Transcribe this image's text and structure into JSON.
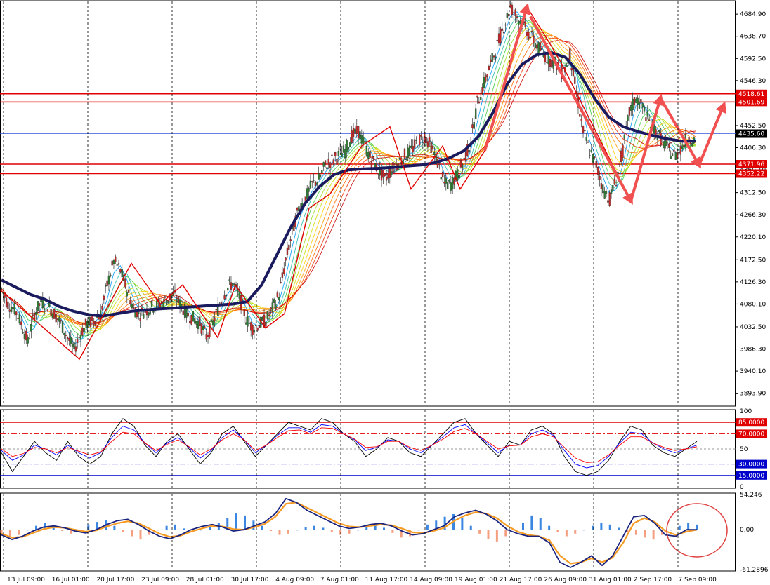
{
  "chart_data": {
    "type": "line",
    "instrument_note": "",
    "main_panel": {
      "type": "candlestick",
      "ylim": [
        3870,
        4710
      ],
      "y_ticks": [
        "4684.90",
        "4638.70",
        "4592.50",
        "4546.30",
        "4500.10",
        "4452.50",
        "4406.30",
        "4360.10",
        "4312.50",
        "4266.30",
        "4220.10",
        "4172.50",
        "4126.30",
        "4080.10",
        "4032.50",
        "3986.30",
        "3940.10",
        "3893.90"
      ],
      "price_tags": [
        {
          "label": "4518.61",
          "value": 4518.61,
          "kind": "red"
        },
        {
          "label": "4501.69",
          "value": 4501.69,
          "kind": "red"
        },
        {
          "label": "4435.60",
          "value": 4435.6,
          "kind": "black"
        },
        {
          "label": "4371.96",
          "value": 4371.96,
          "kind": "red"
        },
        {
          "label": "4352.22",
          "value": 4352.22,
          "kind": "red"
        }
      ],
      "horizontal_lines": [
        {
          "value": 4518.61,
          "color": "#e00000"
        },
        {
          "value": 4501.69,
          "color": "#e00000"
        },
        {
          "value": 4435.6,
          "color": "#3355dd"
        },
        {
          "value": 4371.96,
          "color": "#e00000"
        },
        {
          "value": 4352.22,
          "color": "#e00000"
        }
      ],
      "price_path": [
        4112,
        4080,
        4070,
        4040,
        4000,
        4060,
        4085,
        4078,
        4060,
        4040,
        4010,
        3985,
        4020,
        4040,
        4045,
        4060,
        4120,
        4170,
        4150,
        4110,
        4070,
        4060,
        4068,
        4075,
        4080,
        4090,
        4100,
        4080,
        4060,
        4050,
        4040,
        4012,
        4040,
        4080,
        4110,
        4125,
        4095,
        4050,
        4030,
        4038,
        4045,
        4070,
        4100,
        4170,
        4230,
        4280,
        4300,
        4330,
        4340,
        4370,
        4380,
        4390,
        4400,
        4430,
        4440,
        4410,
        4380,
        4360,
        4340,
        4360,
        4375,
        4390,
        4400,
        4420,
        4430,
        4410,
        4375,
        4330,
        4330,
        4350,
        4380,
        4420,
        4500,
        4540,
        4580,
        4620,
        4660,
        4700,
        4680,
        4660,
        4640,
        4620,
        4600,
        4590,
        4580,
        4560,
        4600,
        4520,
        4440,
        4400,
        4370,
        4320,
        4300,
        4340,
        4400,
        4480,
        4510,
        4490,
        4460,
        4440,
        4420,
        4400,
        4390,
        4410,
        4430,
        4420
      ],
      "ma_thick": [
        4130,
        4115,
        4100,
        4090,
        4075,
        4065,
        4058,
        4055,
        4060,
        4065,
        4068,
        4070,
        4072,
        4074,
        4076,
        4078,
        4080,
        4085,
        4120,
        4180,
        4240,
        4290,
        4325,
        4350,
        4360,
        4362,
        4363,
        4365,
        4368,
        4370,
        4375,
        4385,
        4400,
        4430,
        4480,
        4540,
        4580,
        4600,
        4605,
        4595,
        4560,
        4510,
        4470,
        4450,
        4440,
        4432,
        4425,
        4420,
        4420
      ],
      "ribbon_colors": [
        "#0099ff",
        "#22bbaa",
        "#44cc44",
        "#99dd22",
        "#ccdd00",
        "#ffcc00",
        "#ff9900",
        "#ff6600",
        "#ee3300",
        "#cc0000"
      ],
      "zigzag": [
        [
          0,
          4110
        ],
        [
          113,
          3965
        ],
        [
          187,
          4165
        ],
        [
          228,
          4080
        ],
        [
          260,
          4120
        ],
        [
          310,
          4010
        ],
        [
          335,
          4120
        ],
        [
          378,
          4030
        ],
        [
          405,
          4060
        ],
        [
          440,
          4280
        ],
        [
          470,
          4310
        ],
        [
          515,
          4410
        ],
        [
          555,
          4450
        ],
        [
          585,
          4320
        ],
        [
          630,
          4410
        ],
        [
          655,
          4320
        ],
        [
          690,
          4400
        ],
        [
          750,
          4700
        ],
        [
          780,
          4630
        ],
        [
          800,
          4580
        ],
        [
          898,
          4295
        ],
        [
          940,
          4510
        ],
        [
          995,
          4370
        ]
      ],
      "arrows": [
        {
          "from": [
            690,
            4400
          ],
          "to": [
            750,
            4700
          ]
        },
        {
          "from": [
            755,
            4680
          ],
          "to": [
            898,
            4295
          ]
        },
        {
          "from": [
            898,
            4295
          ],
          "to": [
            940,
            4510
          ]
        },
        {
          "from": [
            940,
            4510
          ],
          "to": [
            995,
            4370
          ]
        },
        {
          "from": [
            995,
            4370
          ],
          "to": [
            1030,
            4495
          ]
        }
      ]
    },
    "rsi_panel": {
      "type": "line",
      "ylim": [
        0,
        100
      ],
      "y_ticks": [
        "100",
        "50",
        "0"
      ],
      "levels": [
        {
          "label": "85.0000",
          "value": 85,
          "kind": "red",
          "style": "solid"
        },
        {
          "label": "70.0000",
          "value": 70,
          "kind": "red",
          "style": "dashdot"
        },
        {
          "label": "30.0000",
          "value": 30,
          "kind": "blue",
          "style": "dashdot"
        },
        {
          "label": "15.0000",
          "value": 15,
          "kind": "blue",
          "style": "solid"
        }
      ],
      "series": [
        {
          "color": "#000000",
          "values": [
            45,
            20,
            40,
            60,
            45,
            35,
            60,
            40,
            30,
            40,
            70,
            90,
            80,
            55,
            40,
            60,
            70,
            50,
            30,
            45,
            70,
            80,
            60,
            40,
            55,
            70,
            85,
            80,
            75,
            90,
            85,
            70,
            60,
            40,
            50,
            65,
            60,
            45,
            40,
            55,
            70,
            85,
            90,
            70,
            55,
            40,
            60,
            55,
            75,
            80,
            70,
            40,
            20,
            15,
            20,
            35,
            60,
            80,
            75,
            55,
            45,
            40,
            50,
            60
          ]
        },
        {
          "color": "#0000ff",
          "values": [
            48,
            35,
            42,
            55,
            50,
            42,
            55,
            45,
            38,
            45,
            65,
            80,
            75,
            58,
            45,
            58,
            65,
            52,
            38,
            48,
            65,
            75,
            62,
            45,
            55,
            68,
            78,
            78,
            72,
            82,
            80,
            70,
            62,
            48,
            52,
            62,
            60,
            50,
            45,
            55,
            66,
            78,
            82,
            70,
            58,
            45,
            55,
            55,
            70,
            75,
            68,
            48,
            30,
            25,
            28,
            40,
            58,
            72,
            70,
            58,
            50,
            45,
            50,
            55
          ]
        },
        {
          "color": "#ff0000",
          "values": [
            50,
            40,
            44,
            52,
            50,
            45,
            52,
            47,
            42,
            46,
            60,
            72,
            70,
            58,
            48,
            56,
            62,
            53,
            42,
            50,
            62,
            70,
            62,
            48,
            55,
            65,
            74,
            75,
            70,
            78,
            77,
            70,
            63,
            52,
            53,
            60,
            60,
            52,
            48,
            55,
            63,
            73,
            77,
            70,
            60,
            50,
            54,
            55,
            66,
            70,
            66,
            52,
            38,
            32,
            33,
            42,
            55,
            66,
            66,
            58,
            52,
            48,
            50,
            53
          ]
        }
      ]
    },
    "macd_panel": {
      "type": "bar",
      "ylim": [
        -61.2896,
        54.246
      ],
      "y_ticks": [
        "54.246",
        "0.00",
        "-61.2896"
      ],
      "histogram": [
        -5,
        -12,
        -8,
        0,
        6,
        10,
        4,
        -2,
        -6,
        0,
        8,
        12,
        15,
        6,
        -4,
        -10,
        -15,
        -8,
        0,
        6,
        8,
        2,
        -3,
        0,
        5,
        10,
        18,
        25,
        22,
        14,
        6,
        -2,
        -8,
        -6,
        0,
        4,
        6,
        3,
        -4,
        -8,
        -6,
        0,
        5,
        8,
        3,
        -5,
        -12,
        -10,
        0,
        8,
        14,
        20,
        24,
        18,
        6,
        -6,
        -14,
        -18,
        -10,
        0,
        10,
        22,
        18,
        6,
        -4,
        -10,
        -6,
        0,
        6,
        10,
        8,
        3,
        -3,
        -8,
        -12,
        -15,
        -8,
        0,
        6,
        10,
        8
      ],
      "macd_line": [
        -8,
        -15,
        -10,
        -2,
        4,
        6,
        3,
        -2,
        -5,
        0,
        8,
        14,
        16,
        8,
        -2,
        -10,
        -14,
        -8,
        0,
        5,
        8,
        4,
        -2,
        0,
        6,
        12,
        25,
        48,
        42,
        30,
        22,
        14,
        6,
        2,
        4,
        8,
        10,
        6,
        -2,
        -8,
        -6,
        0,
        6,
        20,
        26,
        30,
        24,
        14,
        0,
        -6,
        -10,
        -10,
        -20,
        -50,
        -58,
        -50,
        -40,
        -55,
        -40,
        -10,
        20,
        22,
        10,
        -8,
        -10,
        0,
        0
      ],
      "signal_line": [
        -6,
        -12,
        -11,
        -5,
        1,
        4,
        3,
        0,
        -3,
        -1,
        5,
        10,
        13,
        10,
        2,
        -6,
        -11,
        -9,
        -3,
        2,
        6,
        5,
        1,
        0,
        4,
        9,
        20,
        40,
        42,
        34,
        26,
        18,
        10,
        5,
        4,
        6,
        8,
        7,
        2,
        -4,
        -5,
        -2,
        3,
        14,
        22,
        27,
        25,
        18,
        6,
        -3,
        -8,
        -10,
        -16,
        -40,
        -52,
        -50,
        -44,
        -50,
        -43,
        -20,
        10,
        18,
        12,
        -2,
        -8,
        -3,
        0
      ],
      "highlight_circle": {
        "cx": 992,
        "cy": 756
      }
    },
    "x_ticks": [
      "13 Jul 09:00",
      "16 Jul 01:00",
      "20 Jul 17:00",
      "23 Jul 09:00",
      "28 Jul 01:00",
      "30 Jul 17:00",
      "4 Aug 09:00",
      "7 Aug 01:00",
      "11 Aug 17:00",
      "14 Aug 09:00",
      "19 Aug 01:00",
      "21 Aug 17:00",
      "26 Aug 09:00",
      "31 Aug 01:00",
      "2 Sep 17:00",
      "7 Sep 09:00"
    ]
  }
}
